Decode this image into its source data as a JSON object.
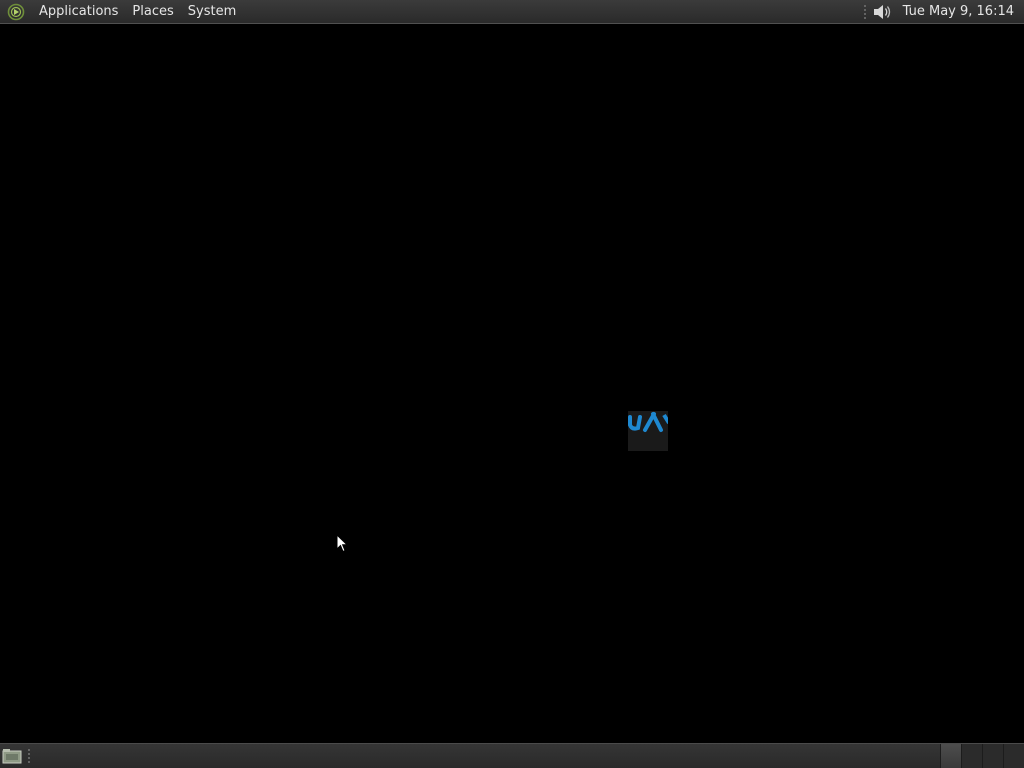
{
  "top_panel": {
    "menus": [
      "Applications",
      "Places",
      "System"
    ],
    "clock": "Tue May  9, 16:14"
  },
  "bottom_panel": {
    "workspaces": [
      {
        "active": true
      },
      {
        "active": false
      },
      {
        "active": false
      },
      {
        "active": false
      }
    ]
  },
  "colors": {
    "panel": "#333333",
    "desktop": "#000000",
    "accent": "#1e88d0",
    "logo": "#6fa040"
  },
  "icons": {
    "menu_logo": "distro-logo-icon",
    "volume": "speaker-volume-icon",
    "show_desktop": "show-desktop-icon",
    "cursor": "mouse-pointer-icon"
  }
}
